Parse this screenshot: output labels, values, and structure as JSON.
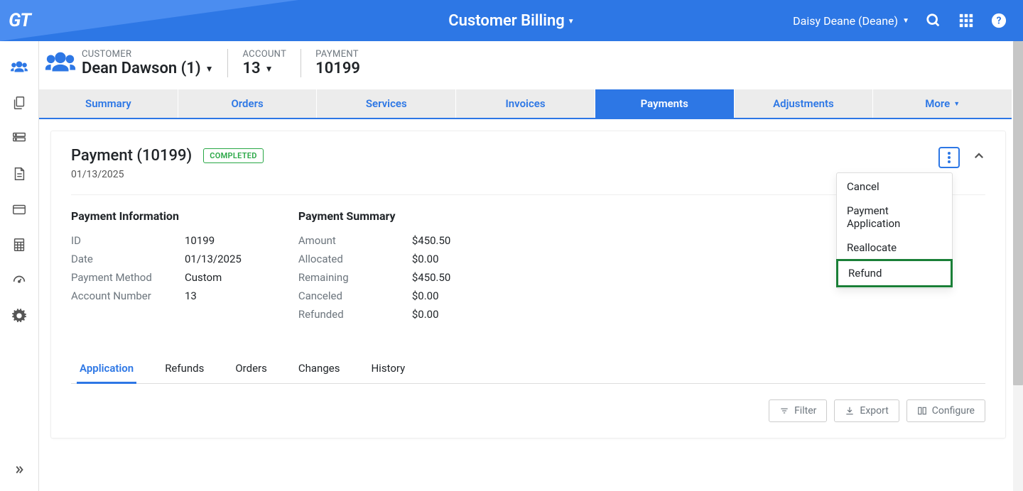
{
  "app": {
    "logo": "GT",
    "title": "Customer Billing",
    "user": "Daisy Deane (Deane)"
  },
  "page_header": {
    "customer_label": "CUSTOMER",
    "customer_value": "Dean Dawson (1)",
    "account_label": "ACCOUNT",
    "account_value": "13",
    "payment_label": "PAYMENT",
    "payment_value": "10199"
  },
  "tabs": {
    "summary": "Summary",
    "orders": "Orders",
    "services": "Services",
    "invoices": "Invoices",
    "payments": "Payments",
    "adjustments": "Adjustments",
    "more": "More"
  },
  "card": {
    "title": "Payment (10199)",
    "status": "COMPLETED",
    "date": "01/13/2025",
    "info": {
      "title": "Payment Information",
      "id_label": "ID",
      "id_value": "10199",
      "date_label": "Date",
      "date_value": "01/13/2025",
      "method_label": "Payment Method",
      "method_value": "Custom",
      "account_label": "Account Number",
      "account_value": "13"
    },
    "summary": {
      "title": "Payment Summary",
      "amount_label": "Amount",
      "amount_value": "$450.50",
      "allocated_label": "Allocated",
      "allocated_value": "$0.00",
      "remaining_label": "Remaining",
      "remaining_value": "$450.50",
      "canceled_label": "Canceled",
      "canceled_value": "$0.00",
      "refunded_label": "Refunded",
      "refunded_value": "$0.00"
    }
  },
  "dropdown": {
    "cancel": "Cancel",
    "payment_application": "Payment Application",
    "reallocate": "Reallocate",
    "refund": "Refund"
  },
  "subtabs": {
    "application": "Application",
    "refunds": "Refunds",
    "orders": "Orders",
    "changes": "Changes",
    "history": "History"
  },
  "toolbar": {
    "filter": "Filter",
    "export": "Export",
    "configure": "Configure"
  }
}
